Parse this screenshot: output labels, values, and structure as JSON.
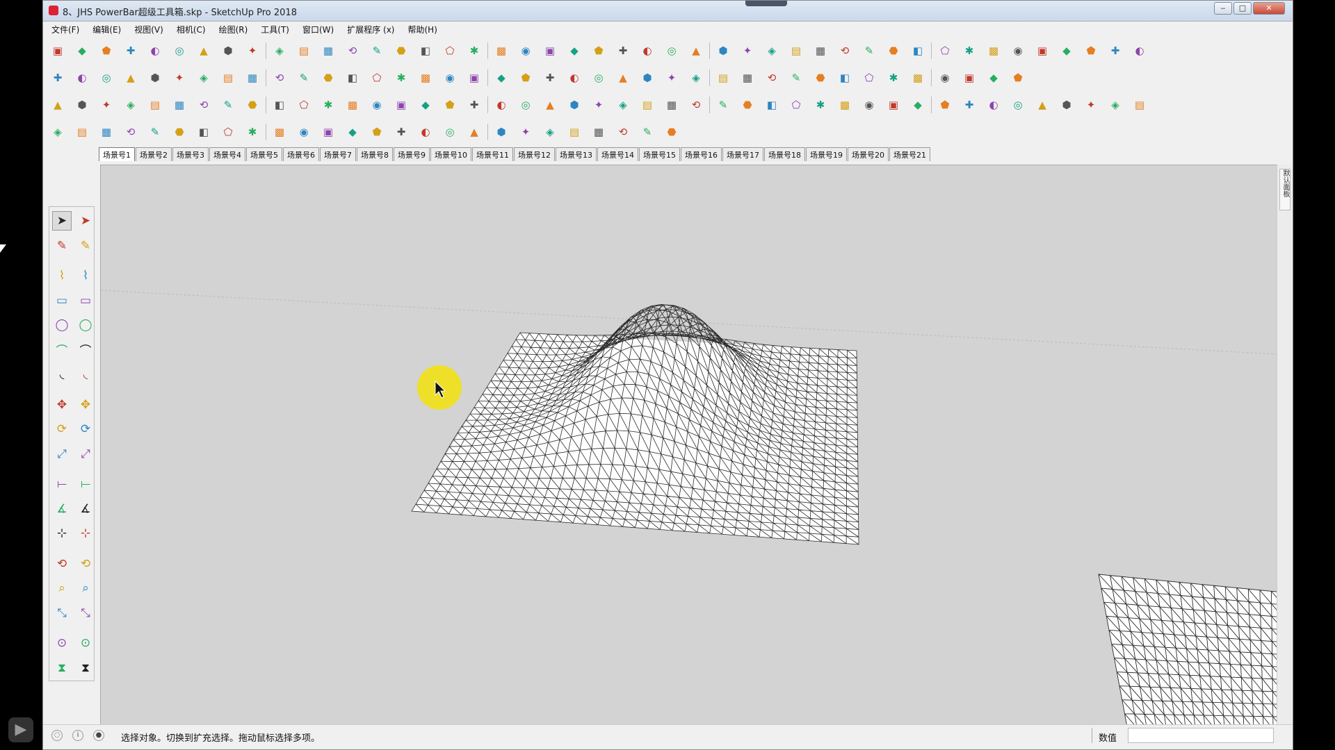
{
  "window": {
    "title": "8、JHS PowerBar超级工具箱.skp - SketchUp Pro 2018",
    "minimize": "‒",
    "maximize": "□",
    "close": "✕"
  },
  "menu": [
    "文件(F)",
    "编辑(E)",
    "视图(V)",
    "相机(C)",
    "绘图(R)",
    "工具(T)",
    "窗口(W)",
    "扩展程序 (x)",
    "帮助(H)"
  ],
  "scene_tabs": [
    "场景号1",
    "场景号2",
    "场景号3",
    "场景号4",
    "场景号5",
    "场景号6",
    "场景号7",
    "场景号8",
    "场景号9",
    "场景号10",
    "场景号11",
    "场景号12",
    "场景号13",
    "场景号14",
    "场景号15",
    "场景号16",
    "场景号17",
    "场景号18",
    "场景号19",
    "场景号20",
    "场景号21"
  ],
  "active_scene_index": 0,
  "right_tray_label": "默认面板",
  "status": {
    "hint": "选择对象。切换到扩充选择。拖动鼠标选择多项。",
    "value_label": "数值",
    "value": ""
  },
  "toolbar_rows": [
    {
      "name": "standard",
      "icons": [
        "new-file-icon",
        "open-icon",
        "save-icon",
        "cut-icon",
        "copy-icon",
        "paste-icon",
        "erase-icon",
        "undo-icon",
        "redo-icon",
        "print-icon",
        "model-info-icon",
        "section-icon",
        "terrain-icon",
        "stamp-icon",
        "drape-icon",
        "add-detail-icon",
        "flip-edge-icon",
        "validate-icon",
        "teapot-icon",
        "hand-icon",
        "layout-icon",
        "doc-icon",
        "frame-icon",
        "frame2-icon",
        "lock-icon",
        "trophy-icon",
        "circle-target-icon",
        "angle-icon",
        "tower-icon",
        "sparkle-icon",
        "dome-icon",
        "disc-icon",
        "sun-icon",
        "car-icon",
        "box-icon",
        "box-outline-icon",
        "leaf-icon",
        "no-icon",
        "cube-solid-icon",
        "cube-outline-icon",
        "shape-a-icon",
        "shape-b-icon",
        "shape-c-icon",
        "layers-icon",
        "shield-icon"
      ]
    },
    {
      "name": "powerbar-1",
      "icons": [
        "select-arrow-icon",
        "scale-up-icon",
        "scale-down-icon",
        "lines-a-icon",
        "lines-b-icon",
        "lines-c-icon",
        "dash-a-icon",
        "dash-b-icon",
        "dash-c-icon",
        "grid-a-icon",
        "grid-b-icon",
        "grid-c-icon",
        "grid-d-icon",
        "grid-e-icon",
        "grid-f-icon",
        "mesh-a-icon",
        "mesh-b-icon",
        "mesh-c-icon",
        "checker-icon",
        "resize-a-icon",
        "resize-b-icon",
        "link-icon",
        "panel-a-icon",
        "panel-b-icon",
        "dash-d-icon",
        "dash-e-icon",
        "ruler-icon",
        "pencil-red-icon",
        "eraser-red-icon",
        "jhs-sketchup-icon",
        "ruby-icon",
        "magnet-icon",
        "refresh-red-icon",
        "diamond-a-icon",
        "diamond-b-icon",
        "diamond-c-icon",
        "gear-a-icon",
        "gear-b-icon",
        "gear-c-icon",
        "red-icon"
      ]
    },
    {
      "name": "powerbar-2",
      "icons": [
        "plane-blue-icon",
        "plane-blue2-icon",
        "plane-yellow-icon",
        "plane-green-icon",
        "plane-red-icon",
        "plane-white-icon",
        "rotate-orange-icon",
        "red-square-icon",
        "stripes-icon",
        "flag-icon",
        "wood-icon",
        "link-chain-icon",
        "curve-icon",
        "node-icon",
        "cross-red-icon",
        "cross-green-icon",
        "cross-blue-icon",
        "cone-icon",
        "cone-multi-icon",
        "triangle-yellow-icon",
        "hook-icon",
        "hook-2-icon",
        "spin-icon",
        "move-4-icon",
        "box-brown-icon",
        "undo-red-icon",
        "bamboo-icon",
        "cube-tools-icon",
        "cube-tools2-icon",
        "cube-tools3-icon",
        "cube-blue-icon",
        "grid-tool-icon",
        "panel-tool-icon",
        "grid-orange-icon",
        "grid-orange2-icon",
        "grid-orange3-icon",
        "dots-red-icon",
        "circle-dots-icon",
        "nodes-icon",
        "house-a-icon",
        "house-b-icon",
        "house-c-icon",
        "house-d-icon",
        "house-e-icon",
        "house-f-icon"
      ]
    },
    {
      "name": "powerbar-3",
      "icons": [
        "curve-a-icon",
        "curve-b-icon",
        "curve-c-icon",
        "curve-d-icon",
        "curve-e-icon",
        "arc-green-icon",
        "rect-icon",
        "circle-icon",
        "arc-a-icon",
        "zigzag-icon",
        "arc-b-icon",
        "arc-c-icon",
        "arc-red-icon",
        "line-green-icon",
        "polygon-icon",
        "wrench-icon",
        "circle-red-icon",
        "triangle-red-icon",
        "sphere-icon",
        "sphere-b-icon",
        "sphere-c-icon",
        "sphere-d-icon",
        "cube-red-icon",
        "sphere-active-icon",
        "tube-icon",
        "help-icon"
      ]
    }
  ],
  "left_tools": [
    [
      "select-icon",
      "component-icon"
    ],
    [
      "paint-bucket-icon",
      "eraser-icon"
    ],
    [
      "line-icon",
      "freehand-icon"
    ],
    [
      "rectangle-icon",
      "rotated-rectangle-icon"
    ],
    [
      "circle-icon",
      "polygon-icon"
    ],
    [
      "arc-icon",
      "pie-icon"
    ],
    [
      "two-point-arc-icon",
      "three-point-arc-icon"
    ],
    [
      "move-icon",
      "push-pull-icon"
    ],
    [
      "rotate-icon",
      "follow-me-icon"
    ],
    [
      "scale-icon",
      "offset-icon"
    ],
    [
      "tape-measure-icon",
      "dimension-icon"
    ],
    [
      "protractor-icon",
      "text-icon"
    ],
    [
      "axes-icon",
      "3d-text-icon"
    ],
    [
      "orbit-icon",
      "pan-icon"
    ],
    [
      "zoom-icon",
      "zoom-window-icon"
    ],
    [
      "zoom-extents-icon",
      "previous-view-icon"
    ],
    [
      "position-camera-icon",
      "look-around-icon"
    ],
    [
      "walk-icon",
      "section-plane-icon"
    ]
  ],
  "colors": {
    "viewport_bg": "#d3d3d3",
    "mesh_line": "#2a2a2a",
    "mesh_face": "#ffffff",
    "cursor_highlight": "#f0e11a"
  }
}
